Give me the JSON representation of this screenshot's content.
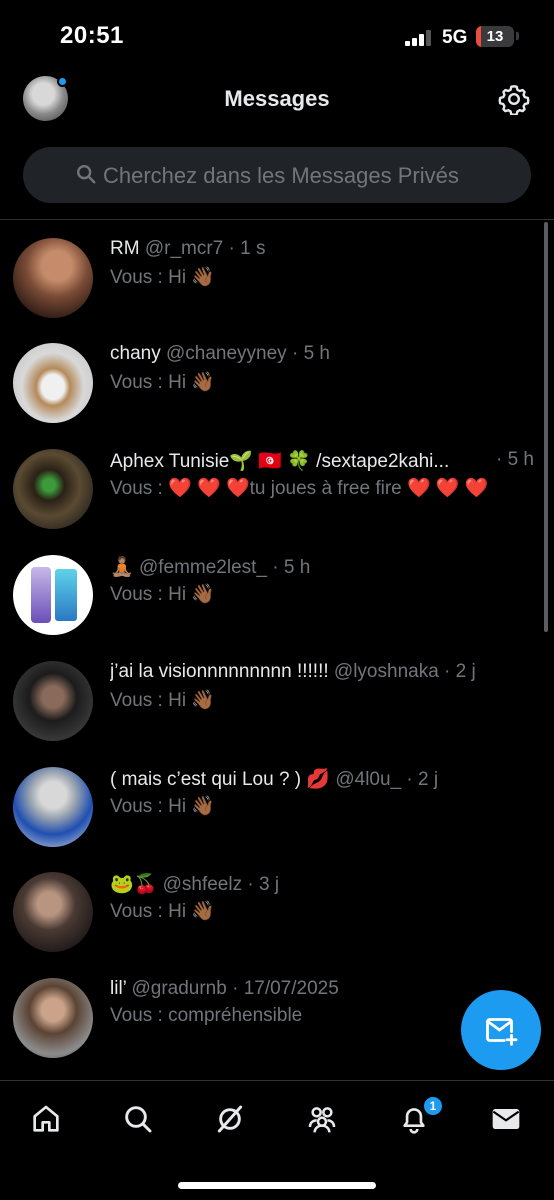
{
  "status": {
    "time": "20:51",
    "network": "5G",
    "battery": "13",
    "battery_level": 0.13
  },
  "header": {
    "title": "Messages"
  },
  "search": {
    "placeholder": "Cherchez dans les Messages Privés"
  },
  "conversations": [
    {
      "name": "RM",
      "handle": "@r_mcr7",
      "time": "1 s",
      "preview": "Vous : Hi 👋🏾"
    },
    {
      "name": "chany",
      "handle": "@chaneyyney",
      "time": "5 h",
      "preview": "Vous : Hi 👋🏾"
    },
    {
      "name": "Aphex Tunisie🌱 🇹🇳 🍀 /sextape2kahi...",
      "handle": "",
      "time": "5 h",
      "preview": "Vous : ❤️ ❤️ ❤️tu joues à free fire ❤️ ❤️ ❤️"
    },
    {
      "name": "🧘🏽",
      "handle": "@femme2lest_",
      "time": "5 h",
      "preview": "Vous : Hi 👋🏾"
    },
    {
      "name": "j’ai la visionnnnnnnnn !!!!!!",
      "handle": "@lyoshnaka",
      "time": "2 j",
      "preview": "Vous : Hi 👋🏾"
    },
    {
      "name": "( mais c’est qui Lou ? ) 💋",
      "handle": "@4l0u_",
      "time": "2 j",
      "preview": "Vous : Hi 👋🏾"
    },
    {
      "name": "🐸🍒",
      "handle": "@shfeelz",
      "time": "3 j",
      "preview": "Vous : Hi 👋🏾"
    },
    {
      "name": "lil’",
      "handle": "@gradurnb",
      "time": "17/07/2025",
      "preview": "Vous : compréhensible"
    }
  ],
  "notifications": {
    "badge": "1"
  },
  "colors": {
    "accent": "#1d9bf0",
    "background": "#000000",
    "muted": "#71767b"
  },
  "icons": [
    "settings-gear-icon",
    "search-icon",
    "new-message-icon",
    "home-icon",
    "explore-icon",
    "grok-icon",
    "communities-icon",
    "notifications-bell-icon",
    "messages-envelope-icon"
  ]
}
